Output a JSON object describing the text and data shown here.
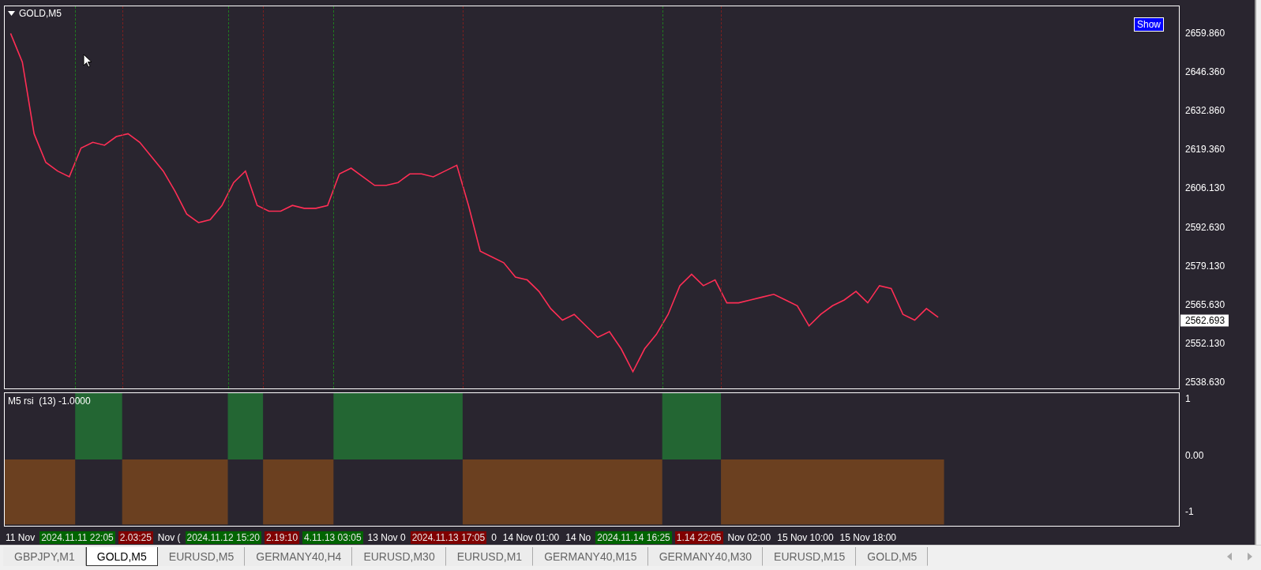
{
  "chart": {
    "title": "GOLD,M5",
    "show_button": "Show",
    "last_price": "2562.693",
    "price_axis": [
      "2659.860",
      "2646.360",
      "2632.860",
      "2619.360",
      "2606.130",
      "2592.630",
      "2579.130",
      "2565.630",
      "2552.130",
      "2538.630"
    ]
  },
  "indicator": {
    "label": "M5 rsi  (13) -1.0000",
    "axis": [
      "1",
      "0.00",
      "-1"
    ]
  },
  "time_axis": [
    {
      "kind": "date",
      "text": "11 Nov"
    },
    {
      "kind": "tag",
      "text": "2024.11.11 22:05",
      "color": "#006400"
    },
    {
      "kind": "tag",
      "text": "2.03:25",
      "color": "#800000"
    },
    {
      "kind": "date",
      "text": "Nov ("
    },
    {
      "kind": "tag",
      "text": "2024.11.12 15:20",
      "color": "#006400"
    },
    {
      "kind": "tag",
      "text": "2.19:10",
      "color": "#800000"
    },
    {
      "kind": "tag",
      "text": "4.11.13 03:05",
      "color": "#006400"
    },
    {
      "kind": "date",
      "text": "13 Nov 0"
    },
    {
      "kind": "tag",
      "text": "2024.11.13 17:05",
      "color": "#800000"
    },
    {
      "kind": "date",
      "text": "0"
    },
    {
      "kind": "date",
      "text": "14 Nov 01:00"
    },
    {
      "kind": "date",
      "text": "14 No"
    },
    {
      "kind": "tag",
      "text": "2024.11.14 16:25",
      "color": "#006400"
    },
    {
      "kind": "tag",
      "text": "1.14 22:05",
      "color": "#800000"
    },
    {
      "kind": "date",
      "text": "Nov 02:00"
    },
    {
      "kind": "date",
      "text": "15 Nov 10:00"
    },
    {
      "kind": "date",
      "text": "15 Nov 18:00"
    }
  ],
  "tabs": [
    {
      "label": "GBPJPY,M1",
      "selected": false
    },
    {
      "label": "GOLD,M5",
      "selected": true
    },
    {
      "label": "EURUSD,M5",
      "selected": false
    },
    {
      "label": "GERMANY40,H4",
      "selected": false
    },
    {
      "label": "EURUSD,M30",
      "selected": false
    },
    {
      "label": "EURUSD,M1",
      "selected": false
    },
    {
      "label": "GERMANY40,M15",
      "selected": false
    },
    {
      "label": "GERMANY40,M30",
      "selected": false
    },
    {
      "label": "EURUSD,M15",
      "selected": false
    },
    {
      "label": "GOLD,M5",
      "selected": false
    }
  ]
}
